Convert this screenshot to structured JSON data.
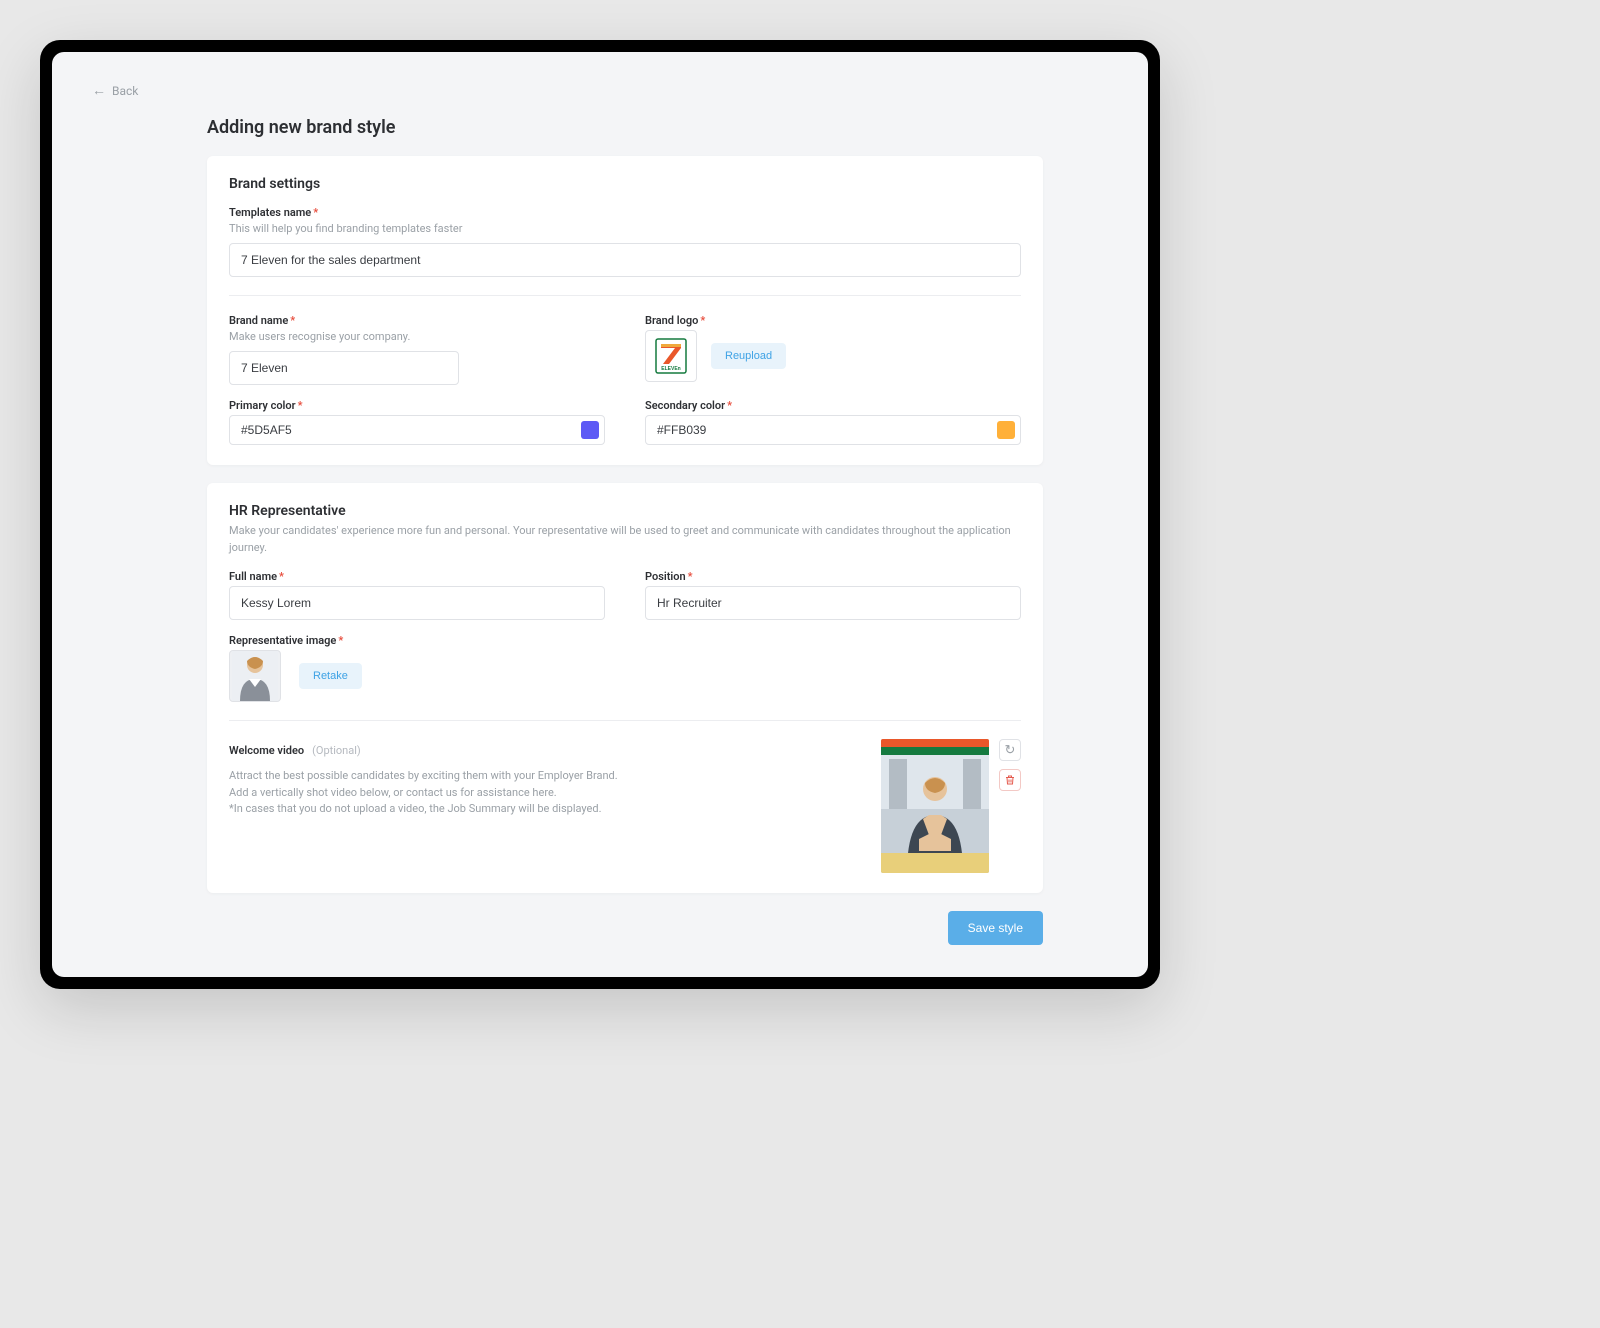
{
  "nav": {
    "back_label": "Back"
  },
  "page": {
    "title": "Adding new brand style"
  },
  "brand_settings": {
    "section_title": "Brand settings",
    "template_name_label": "Templates name",
    "template_name_hint": "This will help you find branding templates faster",
    "template_name_value": "7 Eleven for the sales department",
    "brand_name_label": "Brand name",
    "brand_name_hint": "Make users recognise your company.",
    "brand_name_value": "7 Eleven",
    "brand_logo_label": "Brand logo",
    "reupload_label": "Reupload",
    "primary_color_label": "Primary color",
    "primary_color_value": "#5D5AF5",
    "secondary_color_label": "Secondary color",
    "secondary_color_value": "#FFB039"
  },
  "hr_rep": {
    "section_title": "HR Representative",
    "section_sub": "Make your candidates' experience more fun and personal. Your representative will be used to greet and communicate with candidates throughout the application journey.",
    "full_name_label": "Full name",
    "full_name_value": "Kessy Lorem",
    "position_label": "Position",
    "position_value": "Hr Recruiter",
    "rep_image_label": "Representative image",
    "retake_label": "Retake",
    "welcome_label": "Welcome video",
    "welcome_optional": "(Optional)",
    "welcome_desc_1": "Attract the best possible candidates by exciting them with your Employer Brand.",
    "welcome_desc_2": "Add a vertically shot video below, or contact us for assistance here.",
    "welcome_desc_3": "*In cases that you do not upload a video, the Job Summary will be displayed."
  },
  "actions": {
    "save_label": "Save style"
  },
  "colors": {
    "primary_swatch": "#5d5af5",
    "secondary_swatch": "#ffb039"
  }
}
